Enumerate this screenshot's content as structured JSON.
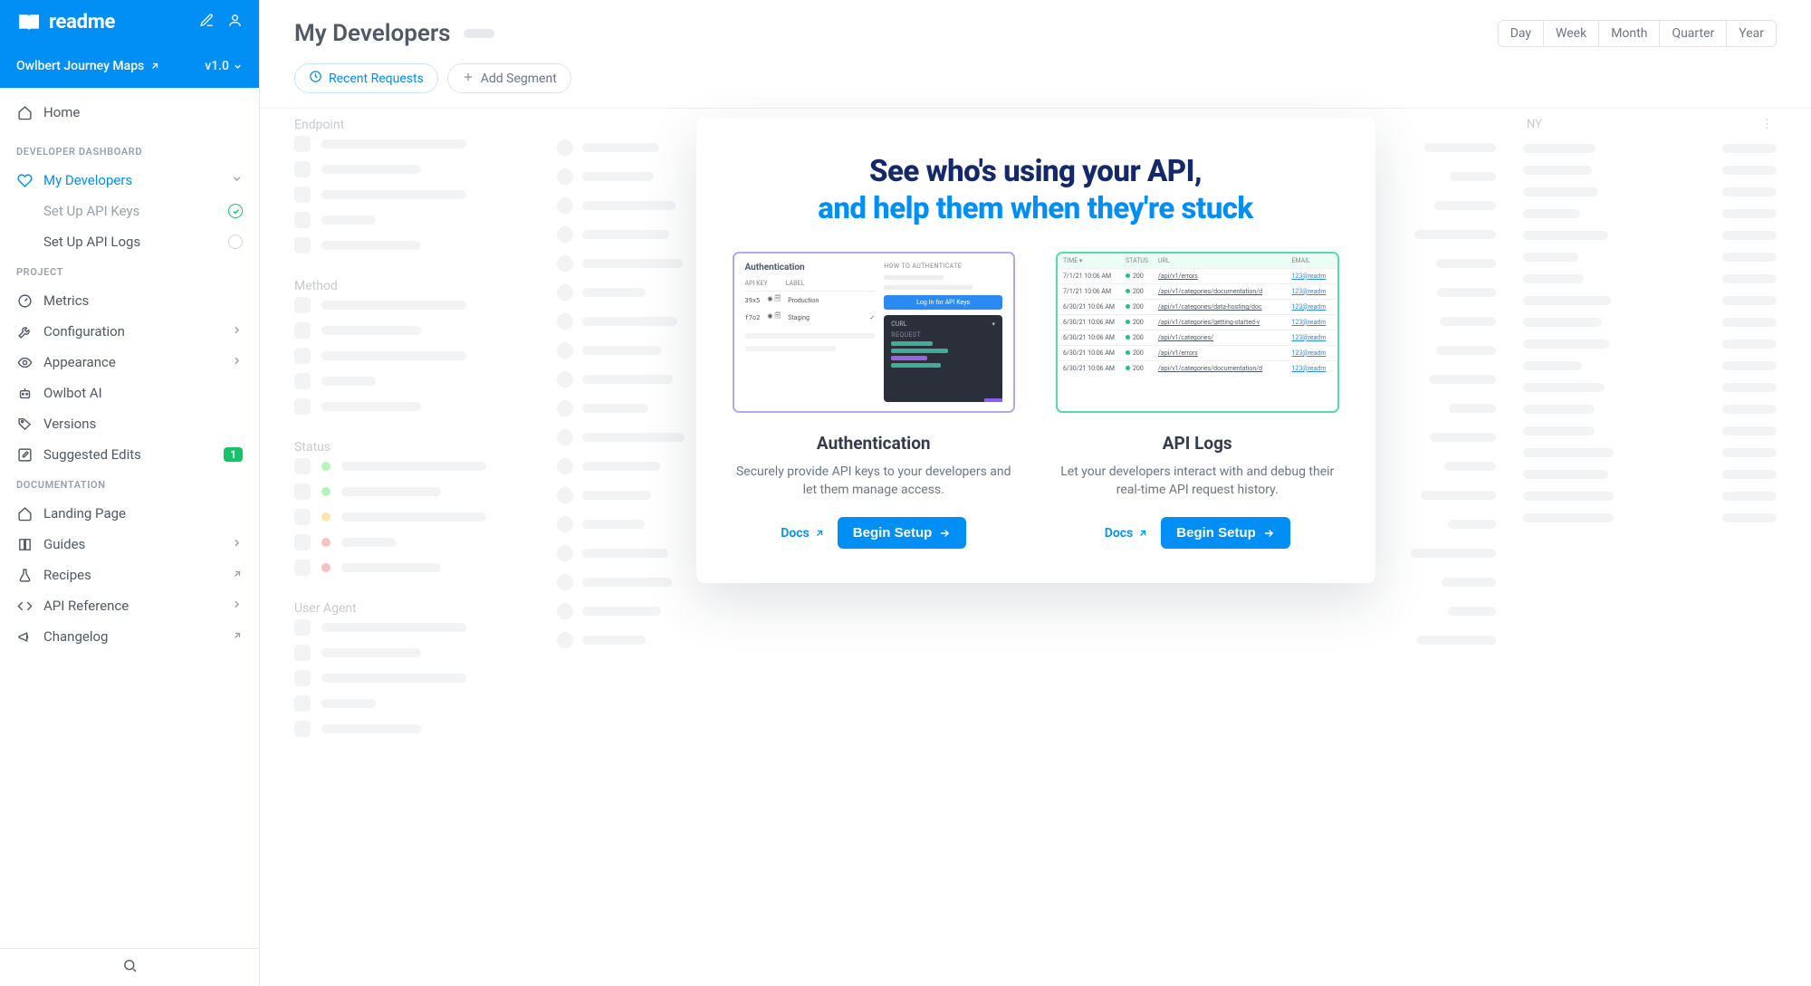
{
  "brand": "readme",
  "project": {
    "name": "Owlbert Journey Maps",
    "version": "v1.0"
  },
  "nav": {
    "home": "Home",
    "sections": {
      "developer_dashboard": "Developer Dashboard",
      "project": "Project",
      "documentation": "Documentation"
    },
    "my_developers": {
      "label": "My Developers",
      "sub": [
        {
          "label": "Set Up API Keys",
          "done": true
        },
        {
          "label": "Set Up API Logs",
          "done": false
        }
      ]
    },
    "project_items": [
      {
        "label": "Metrics",
        "icon": "gauge"
      },
      {
        "label": "Configuration",
        "icon": "wrench",
        "chevron": true
      },
      {
        "label": "Appearance",
        "icon": "eye",
        "chevron": true
      },
      {
        "label": "Owlbot AI",
        "icon": "robot"
      },
      {
        "label": "Versions",
        "icon": "tag"
      },
      {
        "label": "Suggested Edits",
        "icon": "pencil-square",
        "badge": "1"
      }
    ],
    "doc_items": [
      {
        "label": "Landing Page",
        "icon": "home"
      },
      {
        "label": "Guides",
        "icon": "book",
        "chevron": true
      },
      {
        "label": "Recipes",
        "icon": "flask",
        "ext": true
      },
      {
        "label": "API Reference",
        "icon": "code",
        "chevron": true
      },
      {
        "label": "Changelog",
        "icon": "megaphone",
        "ext": true
      }
    ]
  },
  "page": {
    "title": "My Developers",
    "ranges": [
      "Day",
      "Week",
      "Month",
      "Quarter",
      "Year"
    ],
    "filters": {
      "recent": "Recent Requests",
      "add_segment": "Add Segment"
    },
    "groups": [
      "Endpoint",
      "Method",
      "Status",
      "User Agent"
    ],
    "col2_right": "NY"
  },
  "modal": {
    "headline1": "See who's using your API,",
    "headline2": "and help them when they're stuck",
    "auth": {
      "title": "Authentication",
      "desc": "Securely provide API keys to your developers and let them manage access.",
      "docs": "Docs",
      "cta": "Begin Setup",
      "preview": {
        "title": "Authentication",
        "cols": [
          "API KEY",
          "LABEL"
        ],
        "rows": [
          {
            "key": "39x5",
            "label": "Production"
          },
          {
            "key": "f7o2",
            "label": "Staging"
          }
        ],
        "how": "HOW TO AUTHENTICATE",
        "login_btn": "Log In for API Keys",
        "request_tabs": [
          "CURL"
        ],
        "request_label": "REQUEST"
      }
    },
    "logs": {
      "title": "API Logs",
      "desc": "Let your developers interact with and debug their real-time API request history.",
      "docs": "Docs",
      "cta": "Begin Setup",
      "preview": {
        "headers": [
          "TIME",
          "STATUS",
          "URL",
          "EMAIL"
        ],
        "rows": [
          {
            "time": "7/1/21 10:06 AM",
            "status": "200",
            "url": "/api/v1/errors",
            "email": "123@readm"
          },
          {
            "time": "7/1/21 10:06 AM",
            "status": "200",
            "url": "/api/v1/categories/documentation/d",
            "email": "123@readm"
          },
          {
            "time": "6/30/21 10:06 AM",
            "status": "200",
            "url": "/api/v1/categories/data-hosting/doc",
            "email": "123@readm"
          },
          {
            "time": "6/30/21 10:06 AM",
            "status": "200",
            "url": "/api/v1/categories/getting-started-v",
            "email": "123@readm"
          },
          {
            "time": "6/30/21 10:06 AM",
            "status": "200",
            "url": "/api/v1/categories/",
            "email": "123@readm"
          },
          {
            "time": "6/30/21 10:06 AM",
            "status": "200",
            "url": "/api/v1/errors",
            "email": "123@readm"
          },
          {
            "time": "6/30/21 10:06 AM",
            "status": "200",
            "url": "/api/v1/categories/documentation/d",
            "email": "123@readm"
          }
        ]
      }
    }
  }
}
